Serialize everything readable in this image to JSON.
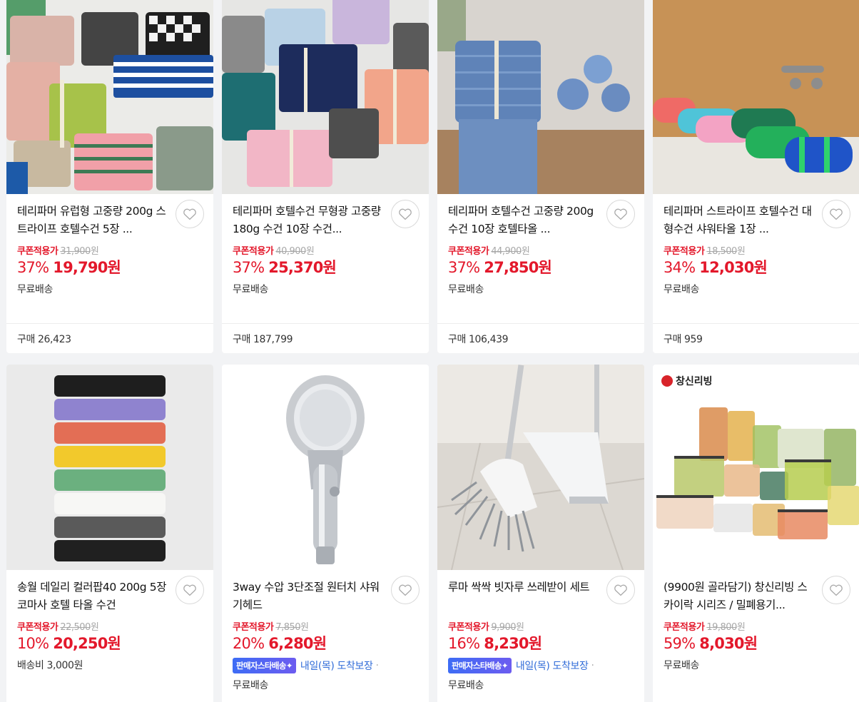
{
  "products": [
    {
      "title": "테리파머 유럽형 고중량 200g 스트라이프 호텔수건 5장 ...",
      "coupon_label": "쿠폰적용가",
      "original_price": "31,900",
      "won_small": "원",
      "discount": "37%",
      "price": "19,790원",
      "shipping": "무료배송",
      "purchases": "구매 26,423"
    },
    {
      "title": "테리파머 호텔수건 무형광 고중량 180g 수건 10장 수건...",
      "coupon_label": "쿠폰적용가",
      "original_price": "40,900",
      "won_small": "원",
      "discount": "37%",
      "price": "25,370원",
      "shipping": "무료배송",
      "purchases": "구매 187,799"
    },
    {
      "title": "테리파머 호텔수건 고중량 200g 수건 10장 호텔타올 ...",
      "coupon_label": "쿠폰적용가",
      "original_price": "44,900",
      "won_small": "원",
      "discount": "37%",
      "price": "27,850원",
      "shipping": "무료배송",
      "purchases": "구매 106,439"
    },
    {
      "title": "테리파머 스트라이프 호텔수건 대형수건 샤워타올 1장 ...",
      "coupon_label": "쿠폰적용가",
      "original_price": "18,500",
      "won_small": "원",
      "discount": "34%",
      "price": "12,030원",
      "shipping": "무료배송",
      "purchases": "구매 959"
    },
    {
      "title": "송월 데일리 컬러팝40 200g 5장 코마사 호텔 타올 수건",
      "coupon_label": "쿠폰적용가",
      "original_price": "22,500",
      "won_small": "원",
      "discount": "10%",
      "price": "20,250원",
      "shipping": "배송비 3,000원"
    },
    {
      "title": "3way 수압 3단조절 원터치 샤워기헤드",
      "coupon_label": "쿠폰적용가",
      "original_price": "7,850",
      "won_small": "원",
      "discount": "20%",
      "price": "6,280원",
      "badge": "판매자스타배송✦",
      "arrival": "내일(목) 도착보장",
      "dot": "·",
      "shipping": "무료배송"
    },
    {
      "title": "루마 싹싹 빗자루 쓰레받이 세트",
      "coupon_label": "쿠폰적용가",
      "original_price": "9,900",
      "won_small": "원",
      "discount": "16%",
      "price": "8,230원",
      "badge": "판매자스타배송✦",
      "arrival": "내일(목) 도착보장",
      "dot": "·",
      "shipping": "무료배송"
    },
    {
      "title": "(9900원 골라담기) 창신리빙 스카이락 시리즈 / 밀폐용기...",
      "coupon_label": "쿠폰적용가",
      "original_price": "19,800",
      "won_small": "원",
      "discount": "59%",
      "price": "8,030원",
      "shipping": "무료배송",
      "brand_logo": "창신리빙"
    }
  ],
  "icons": {
    "heart": "heart-outline-icon"
  },
  "colors": {
    "discount_red": "#e3182b",
    "arrival_blue": "#2f6bd8",
    "badge_gradient": "#3d6cf5"
  }
}
